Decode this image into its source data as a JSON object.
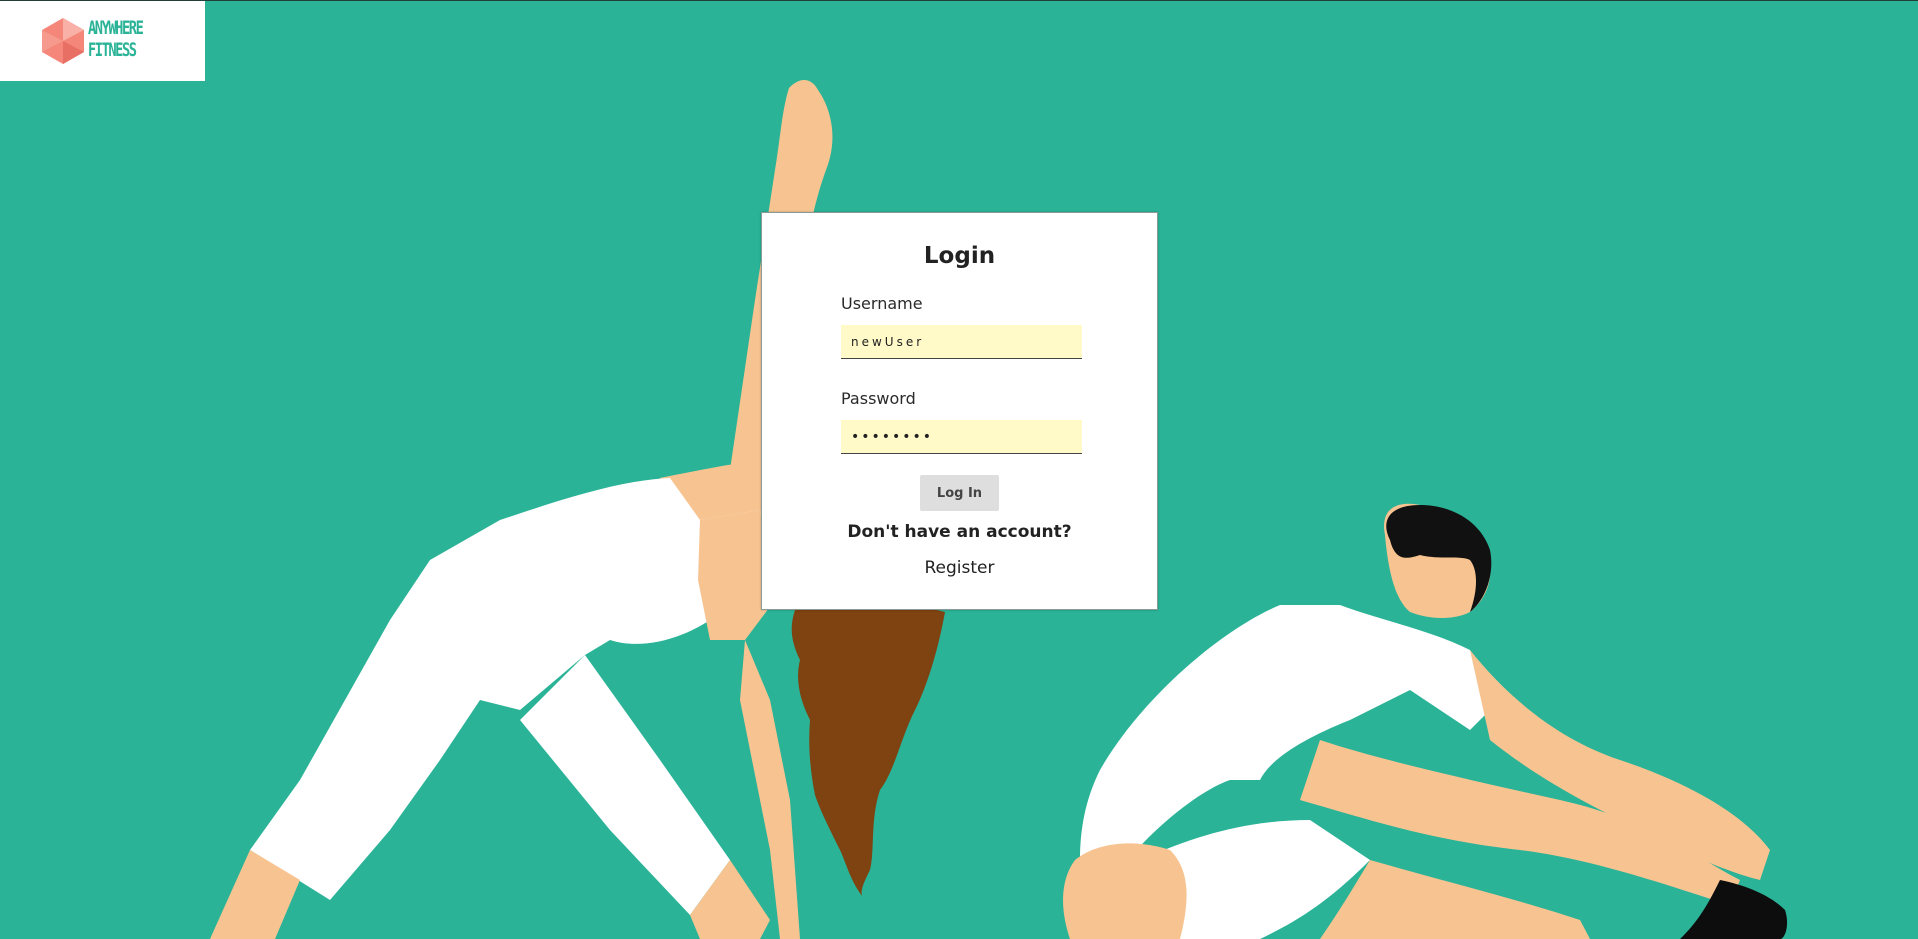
{
  "brand": {
    "logo_text_line1": "ANYWHERE",
    "logo_text_line2": "FITNESS",
    "accent_color": "#2ab397",
    "logo_mark_color": "#f4877a"
  },
  "login": {
    "title": "Login",
    "username_label": "Username",
    "username_value": "newUser",
    "password_label": "Password",
    "password_value": "••••••••",
    "submit_label": "Log In",
    "no_account_text": "Don't have an account?",
    "register_label": "Register"
  },
  "colors": {
    "background": "#2ab397",
    "input_fill": "#fffac8",
    "button_fill": "#dedede"
  }
}
